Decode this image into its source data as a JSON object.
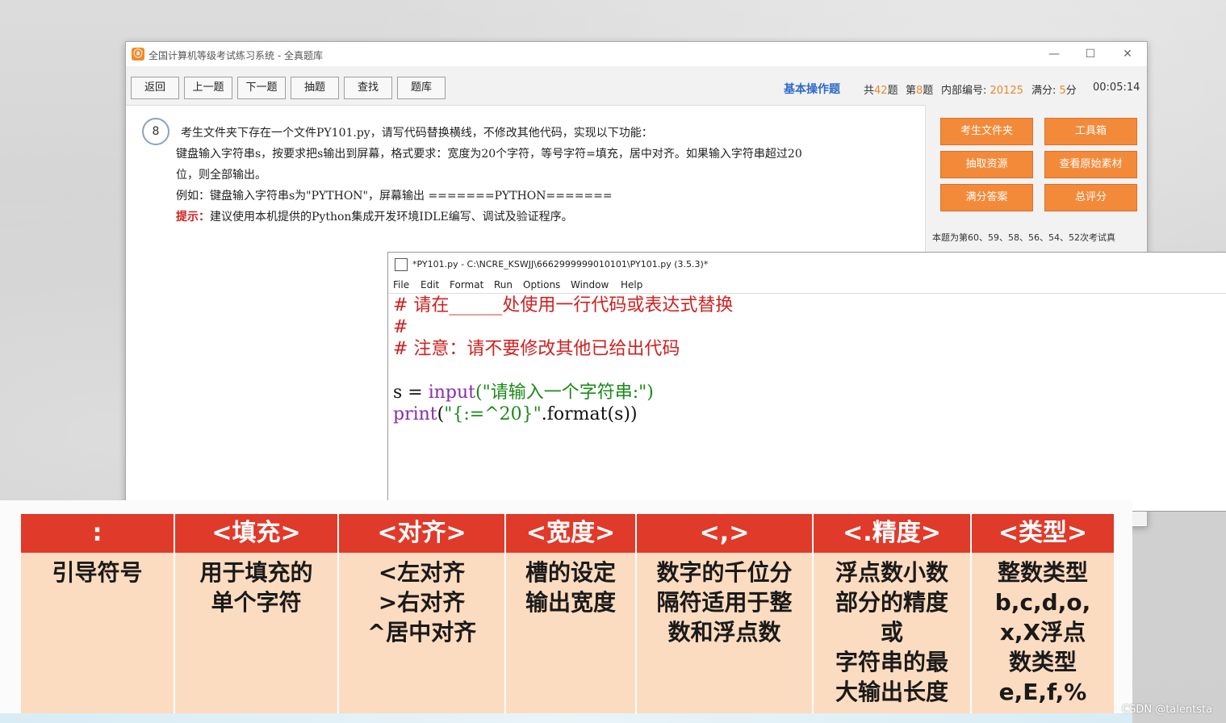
{
  "window": {
    "title": "全国计算机等级考试练习系统 - 全真题库",
    "controls": {
      "minimize": "—",
      "maximize": "☐",
      "close": "✕"
    }
  },
  "toolbar": {
    "buttons": [
      "返回",
      "上一题",
      "下一题",
      "抽题",
      "查找",
      "题库"
    ],
    "question_type": "基本操作题",
    "info": {
      "total_pre": "共",
      "total_num": "42",
      "total_post": "题",
      "index_pre": "第",
      "index_num": "8",
      "index_post": "题",
      "code_label": "内部编号: ",
      "code_value": "20125",
      "score_label": "满分: ",
      "score_value": "5",
      "score_unit": "分"
    },
    "timer": "00:05:14"
  },
  "question": {
    "number": "8",
    "line1": "考生文件夹下存在一个文件PY101.py，请写代码替换横线，不修改其他代码，实现以下功能：",
    "line2": "键盘输入字符串s，按要求把s输出到屏幕，格式要求：宽度为20个字符，等号字符=填充，居中对齐。如果输入字符串超过20",
    "line3": "位，则全部输出。",
    "line4": "例如：键盘输入字符串s为\"PYTHON\"，屏幕输出 =======PYTHON=======",
    "hint_label": "提示：",
    "hint_text": "建议使用本机提供的Python集成开发环境IDLE编写、调试及验证程序。"
  },
  "side": {
    "buttons": [
      "考生文件夹",
      "工具箱",
      "抽取资源",
      "查看原始素材",
      "满分答案",
      "总评分"
    ],
    "note": "本题为第60、59、58、56、54、52次考试真"
  },
  "idle": {
    "title": "*PY101.py - C:\\NCRE_KSWJJ\\6662999999010101\\PY101.py (3.5.3)*",
    "menu": [
      "File",
      "Edit",
      "Format",
      "Run",
      "Options",
      "Window",
      "Help"
    ],
    "code": {
      "line1": "# 请在______处使用一行代码或表达式替换",
      "line2": "#",
      "line3": "# 注意：请不要修改其他已给出代码",
      "line5_a": "s = ",
      "line5_b": "input",
      "line5_c": "(\"请输入一个字符串:\")",
      "line6_a": "print",
      "line6_b": "(",
      "line6_c": "\"{:=^20}\"",
      "line6_d": ".format(s))"
    }
  },
  "slide_table": {
    "headers": [
      ":",
      "<填充>",
      "<对齐>",
      "<宽度>",
      "<,>",
      "<.精度>",
      "<类型>"
    ],
    "cells": [
      "引导符号",
      "用于填充的\n单个字符",
      "<左对齐\n>右对齐\n^居中对齐",
      "槽的设定\n输出宽度",
      "数字的千位分\n隔符适用于整\n数和浮点数",
      "浮点数小数\n部分的精度\n或\n字符串的最\n大输出长度",
      "整数类型\nb,c,d,o,\nx,X浮点\n数类型\ne,E,f,%"
    ],
    "header_color": "#e03a2a",
    "cell_color": "#fcdcc0"
  },
  "watermark": "CSDN @talentsta"
}
